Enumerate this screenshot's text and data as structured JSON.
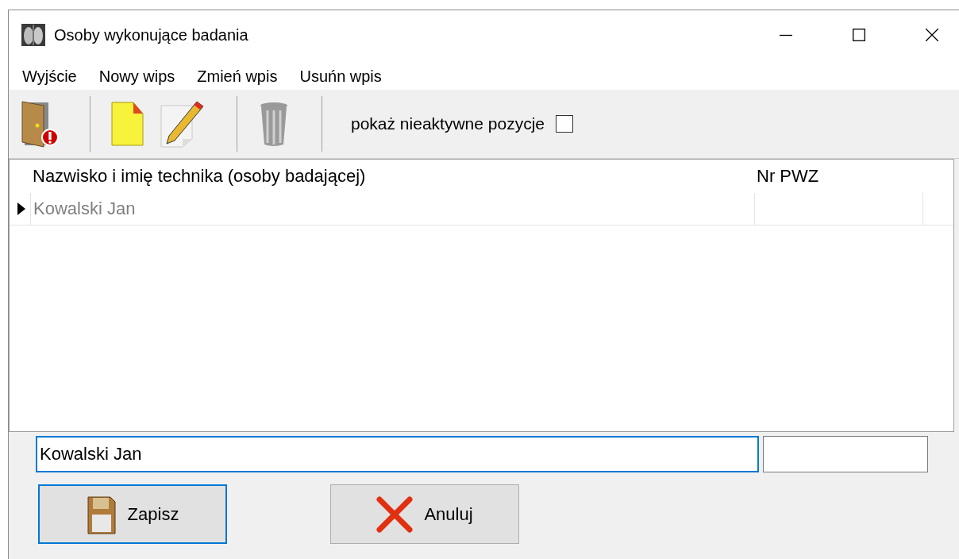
{
  "window": {
    "title": "Osoby wykonujące badania"
  },
  "menu": [
    {
      "label": "Wyjście"
    },
    {
      "label": "Nowy wips"
    },
    {
      "label": "Zmień wpis"
    },
    {
      "label": "Usuńn wpis"
    }
  ],
  "toolbar": {
    "items": [
      {
        "kind": "exit"
      },
      {
        "kind": "separator"
      },
      {
        "kind": "new"
      },
      {
        "kind": "edit"
      },
      {
        "kind": "separator"
      },
      {
        "kind": "delete"
      },
      {
        "kind": "separator"
      }
    ],
    "checkbox": {
      "label": "pokaż nieaktywne pozycje",
      "checked": false
    }
  },
  "table": {
    "columns": [
      "Nazwisko i imię technika (osoby badającej)",
      "Nr PWZ"
    ],
    "rows": [
      {
        "name": "Kowalski Jan",
        "current": true
      }
    ]
  },
  "form": {
    "name_field": {
      "value": "Kowalski Jan",
      "focused": true
    },
    "pwz_field": {
      "focused": false
    }
  },
  "buttons": [
    {
      "label": "Zapisz",
      "kind": "save",
      "focused": true
    },
    {
      "label": "Anuluj",
      "kind": "cancel",
      "focused": false
    }
  ]
}
